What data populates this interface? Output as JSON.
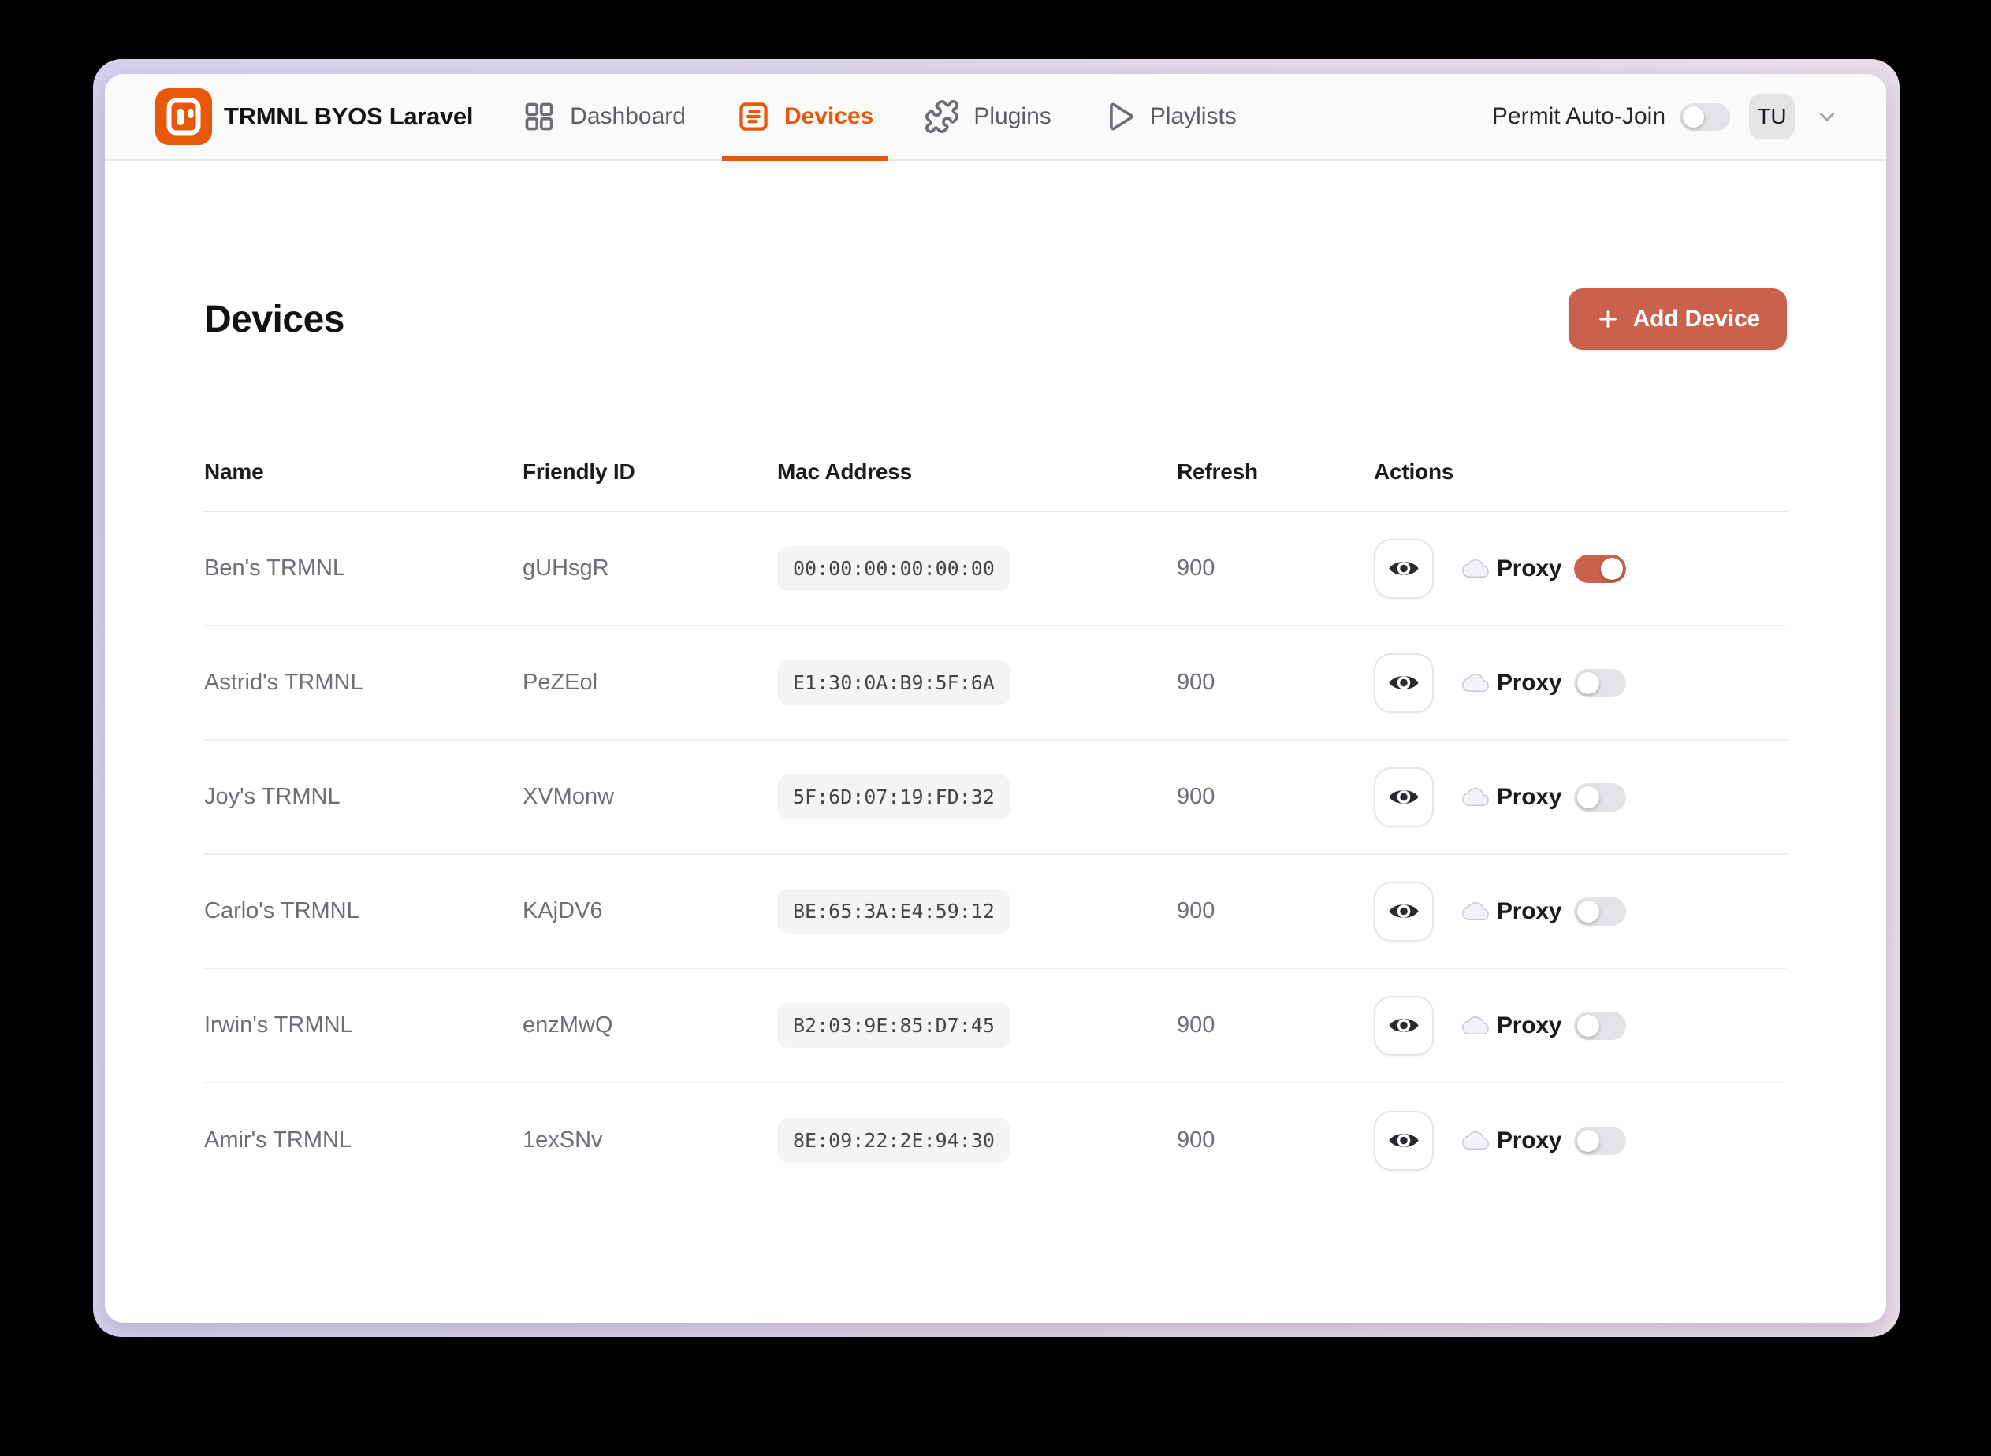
{
  "app_title": "TRMNL BYOS Laravel",
  "nav": {
    "dashboard": "Dashboard",
    "devices": "Devices",
    "plugins": "Plugins",
    "playlists": "Playlists",
    "active_tab": "Devices"
  },
  "header_right": {
    "permit_label": "Permit Auto-Join",
    "permit_enabled": false,
    "user_initials": "TU"
  },
  "page": {
    "title": "Devices",
    "add_device_label": "Add Device"
  },
  "table": {
    "columns": [
      "Name",
      "Friendly ID",
      "Mac Address",
      "Refresh",
      "Actions"
    ],
    "proxy_label": "Proxy",
    "rows": [
      {
        "name": "Ben's TRMNL",
        "friendly_id": "gUHsgR",
        "mac": "00:00:00:00:00:00",
        "refresh": "900",
        "proxy_on": true
      },
      {
        "name": "Astrid's TRMNL",
        "friendly_id": "PeZEol",
        "mac": "E1:30:0A:B9:5F:6A",
        "refresh": "900",
        "proxy_on": false
      },
      {
        "name": "Joy's TRMNL",
        "friendly_id": "XVMonw",
        "mac": "5F:6D:07:19:FD:32",
        "refresh": "900",
        "proxy_on": false
      },
      {
        "name": "Carlo's TRMNL",
        "friendly_id": "KAjDV6",
        "mac": "BE:65:3A:E4:59:12",
        "refresh": "900",
        "proxy_on": false
      },
      {
        "name": "Irwin's TRMNL",
        "friendly_id": "enzMwQ",
        "mac": "B2:03:9E:85:D7:45",
        "refresh": "900",
        "proxy_on": false
      },
      {
        "name": "Amir's TRMNL",
        "friendly_id": "1exSNv",
        "mac": "8E:09:22:2E:94:30",
        "refresh": "900",
        "proxy_on": false
      }
    ]
  },
  "icons": {
    "brand": "trmnl-logo-icon",
    "dashboard": "grid-icon",
    "devices": "list-panel-icon",
    "plugins": "puzzle-icon",
    "playlists": "play-icon",
    "user_menu": "chevron-down-icon",
    "add_device": "plus-icon",
    "view_device": "eye-icon",
    "proxy": "cloud-icon"
  },
  "colors": {
    "brand_orange": "#e8580c",
    "accent_terracotta": "#ca614d",
    "toggle_off_gray": "#e3e3e7",
    "frame_gradient_left": "#d6d2ed",
    "frame_gradient_right": "#ecdfe7"
  }
}
